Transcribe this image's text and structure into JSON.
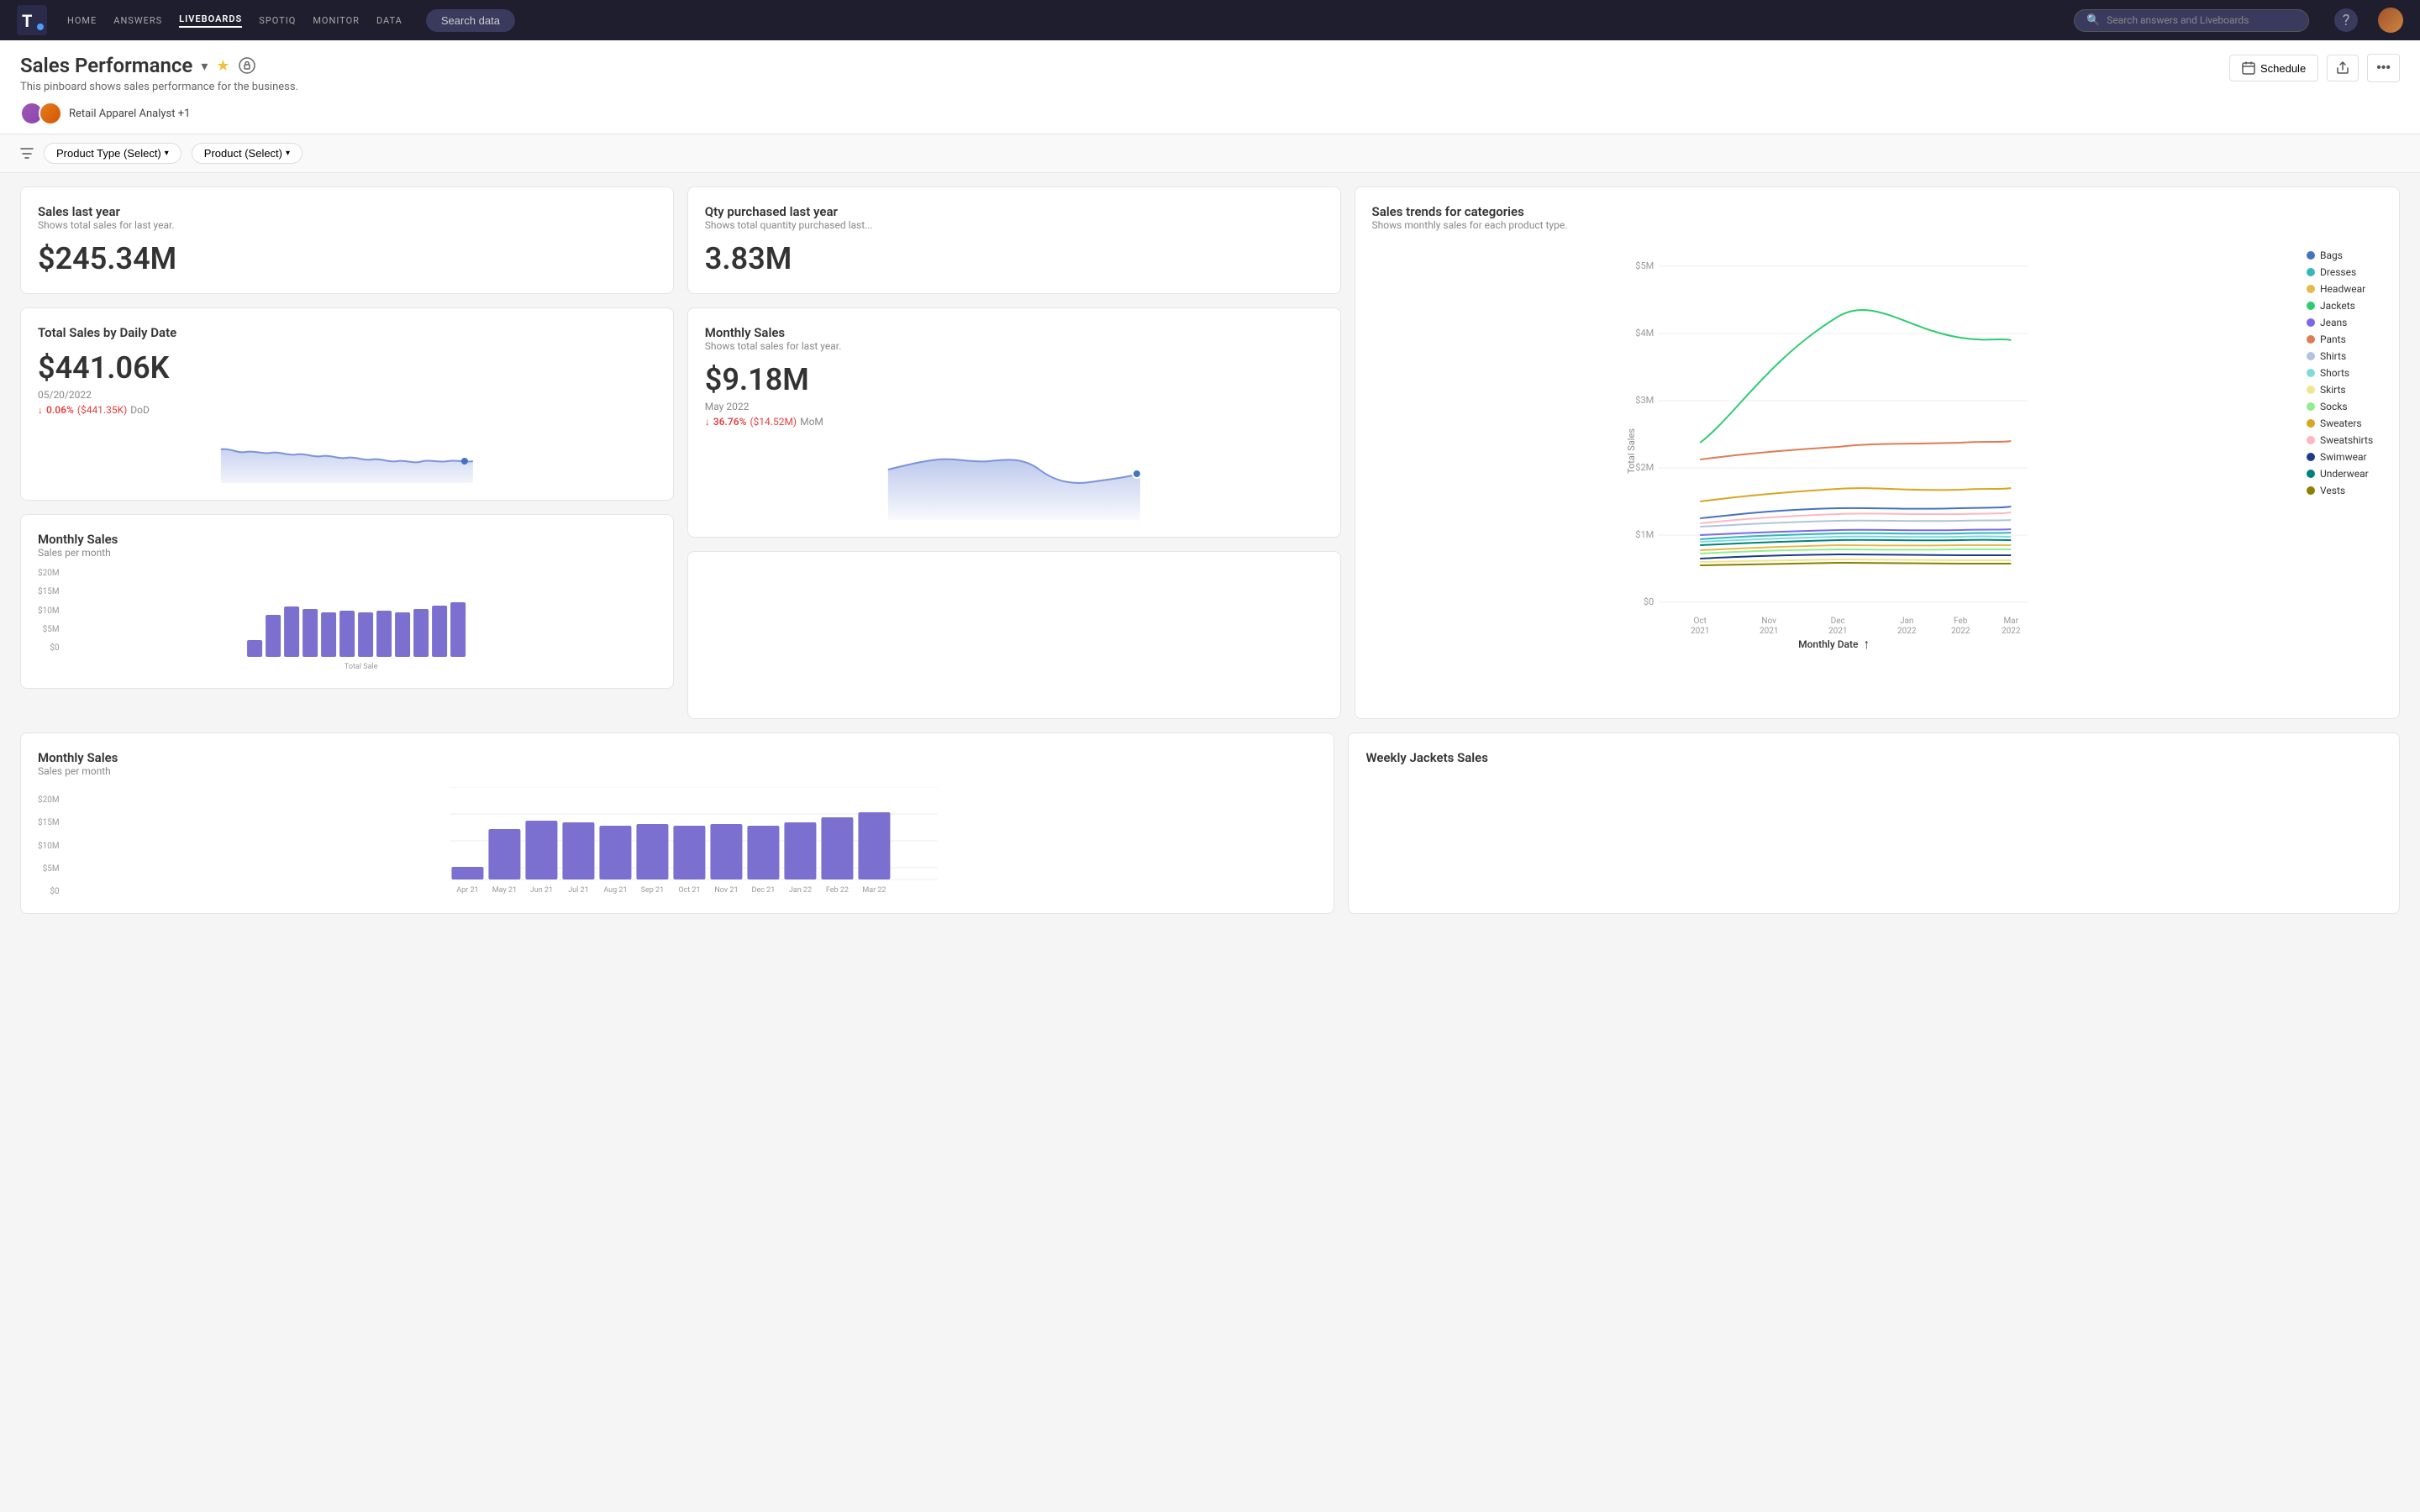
{
  "nav": {
    "logo": "T",
    "links": [
      "HOME",
      "ANSWERS",
      "LIVEBOARDS",
      "SPOTIQ",
      "MONITOR",
      "DATA"
    ],
    "active_link": "LIVEBOARDS",
    "search_data_label": "Search data",
    "search_placeholder": "Search answers and Liveboards"
  },
  "header": {
    "title": "Sales Performance",
    "subtitle": "This pinboard shows sales performance for the business.",
    "authors": "Retail Apparel Analyst +1",
    "schedule_label": "Schedule"
  },
  "filters": {
    "filter1": "Product Type (Select)",
    "filter2": "Product (Select)"
  },
  "cards": {
    "sales_last_year": {
      "title": "Sales last year",
      "subtitle": "Shows total sales for last year.",
      "value": "$245.34M"
    },
    "qty_purchased": {
      "title": "Qty purchased last year",
      "subtitle": "Shows total quantity purchased last...",
      "value": "3.83M"
    },
    "total_sales_daily": {
      "title": "Total Sales by Daily Date",
      "value": "$441.06K",
      "date": "05/20/2022",
      "change_pct": "0.06%",
      "change_amt": "($441.35K)",
      "change_label": "DoD"
    },
    "monthly_sales": {
      "title": "Monthly Sales",
      "subtitle": "Shows total sales for last year.",
      "value": "$9.18M",
      "date": "May 2022",
      "change_pct": "36.76%",
      "change_amt": "($14.52M)",
      "change_label": "MoM"
    },
    "monthly_sales_bar": {
      "title": "Monthly Sales",
      "subtitle": "Sales per month"
    },
    "sales_trends": {
      "title": "Sales trends for categories",
      "subtitle": "Shows monthly sales for each product type.",
      "x_axis_label": "Monthly Date",
      "y_axis_labels": [
        "$5M",
        "$4M",
        "$3M",
        "$2M",
        "$1M",
        "$0"
      ],
      "x_labels": [
        "Oct\n2021",
        "Nov\n2021",
        "Dec\n2021",
        "Jan\n2022",
        "Feb\n2022",
        "Mar\n2022"
      ],
      "legend": [
        {
          "name": "Bags",
          "color": "#4472C4"
        },
        {
          "name": "Dresses",
          "color": "#36B8B8"
        },
        {
          "name": "Headwear",
          "color": "#E8B84B"
        },
        {
          "name": "Jackets",
          "color": "#2ECC71"
        },
        {
          "name": "Jeans",
          "color": "#7B68EE"
        },
        {
          "name": "Pants",
          "color": "#E07B54"
        },
        {
          "name": "Shirts",
          "color": "#B0C4DE"
        },
        {
          "name": "Shorts",
          "color": "#7FDBDA"
        },
        {
          "name": "Skirts",
          "color": "#F0E68C"
        },
        {
          "name": "Socks",
          "color": "#90EE90"
        },
        {
          "name": "Sweaters",
          "color": "#DAA520"
        },
        {
          "name": "Sweatshirts",
          "color": "#FFB6C1"
        },
        {
          "name": "Swimwear",
          "color": "#1E3A8A"
        },
        {
          "name": "Underwear",
          "color": "#008080"
        },
        {
          "name": "Vests",
          "color": "#8B8000"
        }
      ]
    },
    "weekly_jackets": {
      "title": "Weekly Jackets Sales"
    }
  }
}
